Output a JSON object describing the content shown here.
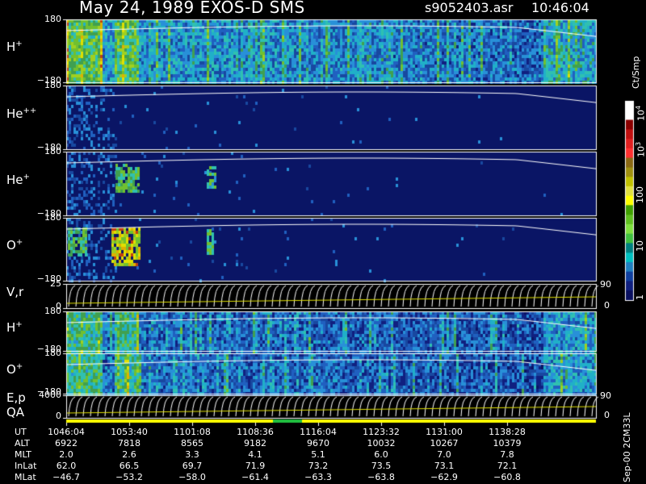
{
  "header": {
    "title": "May 24, 1989   EXOS-D SMS",
    "file": "s9052403.asr",
    "time": "10:46:04"
  },
  "chart_data": {
    "type": "heatmap",
    "panels": [
      {
        "id": "hplus",
        "label": "H",
        "sup": "+",
        "ymax": "180",
        "ymin": "−180",
        "style": "dense"
      },
      {
        "id": "hepp",
        "label": "He",
        "sup": "++",
        "ymax": "180",
        "ymin": "−180",
        "style": "sparse"
      },
      {
        "id": "heplus",
        "label": "He",
        "sup": "+",
        "ymax": "180",
        "ymin": "−180",
        "style": "sparse"
      },
      {
        "id": "oplus",
        "label": "O",
        "sup": "+",
        "ymax": "180",
        "ymin": "−180",
        "style": "sparse"
      },
      {
        "id": "vr",
        "label": "V,r",
        "sup": "",
        "ymax": "25",
        "ymin": "0",
        "right_top": "90",
        "right_bottom": "0",
        "style": "lines"
      },
      {
        "id": "hplus2",
        "label": "H",
        "sup": "+",
        "ymax": "180",
        "ymin": "−180",
        "style": "dense"
      },
      {
        "id": "oplus2",
        "label": "O",
        "sup": "+",
        "ymax": "180",
        "ymin": "−180",
        "style": "dense"
      },
      {
        "id": "ep",
        "label": "E,p",
        "sup": "",
        "label2": "QA",
        "ymax": "4000",
        "ymin": "0",
        "right_top": "90",
        "right_bottom": "0",
        "style": "lines"
      }
    ],
    "colorbar": {
      "title": "Ct/Smp",
      "labels": [
        "10",
        "10",
        "100",
        "10",
        "1"
      ],
      "label_sups": [
        "4",
        "3",
        "",
        "",
        ""
      ],
      "colors": [
        "#ffffff",
        "#ffffff",
        "#8b0000",
        "#c01010",
        "#e02020",
        "#ff3030",
        "#8b6914",
        "#a09010",
        "#c0c000",
        "#e0e040",
        "#ffff00",
        "#40a000",
        "#60c020",
        "#80e040",
        "#40c040",
        "#008080",
        "#00c0c0",
        "#2080c0",
        "#1040a0",
        "#102080",
        "#0a1060"
      ]
    },
    "time_axis": {
      "rows": [
        {
          "name": "UT",
          "values": [
            "1046:04",
            "1053:40",
            "1101:08",
            "1108:36",
            "1116:04",
            "1123:32",
            "1131:00",
            "1138:28"
          ]
        },
        {
          "name": "ALT",
          "values": [
            "6922",
            "7818",
            "8565",
            "9182",
            "9670",
            "10032",
            "10267",
            "10379"
          ]
        },
        {
          "name": "MLT",
          "values": [
            "2.0",
            "2.6",
            "3.3",
            "4.1",
            "5.1",
            "6.0",
            "7.0",
            "7.8"
          ]
        },
        {
          "name": "InLat",
          "values": [
            "62.0",
            "66.5",
            "69.7",
            "71.9",
            "73.2",
            "73.5",
            "73.1",
            "72.1"
          ]
        },
        {
          "name": "MLat",
          "values": [
            "−46.7",
            "−53.2",
            "−58.0",
            "−61.4",
            "−63.3",
            "−63.8",
            "−62.9",
            "−60.8"
          ]
        }
      ]
    }
  },
  "footer": {
    "note": "Sep-00  2CM33L"
  }
}
